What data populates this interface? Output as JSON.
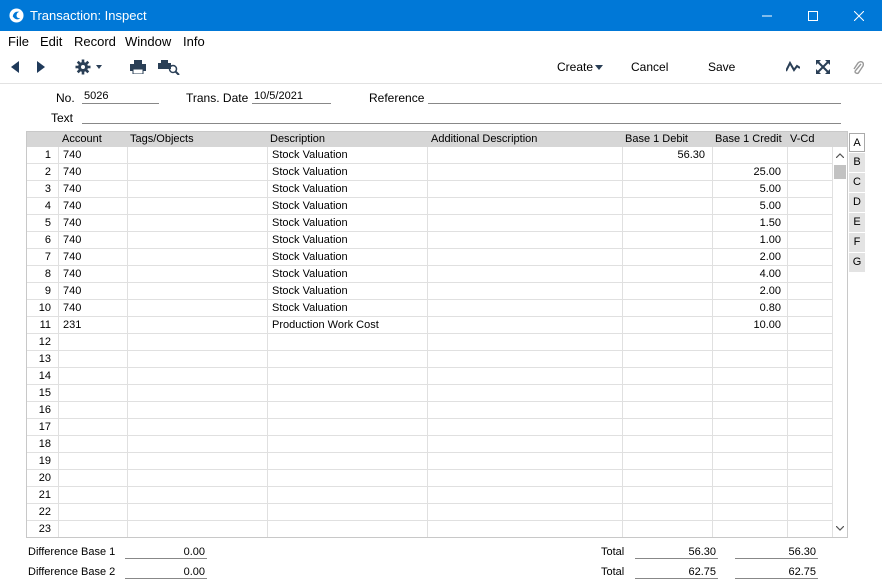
{
  "window": {
    "title": "Transaction: Inspect"
  },
  "menu": [
    "File",
    "Edit",
    "Record",
    "Window",
    "Info"
  ],
  "toolbar": {
    "create_label": "Create",
    "cancel_label": "Cancel",
    "save_label": "Save"
  },
  "header": {
    "no_label": "No.",
    "no_value": "5026",
    "date_label": "Trans. Date",
    "date_value": "10/5/2021",
    "reference_label": "Reference",
    "reference_value": "",
    "text_label": "Text",
    "text_value": ""
  },
  "grid": {
    "columns": [
      "Account",
      "Tags/Objects",
      "Description",
      "Additional Description",
      "Base 1 Debit",
      "Base 1 Credit",
      "V-Cd"
    ],
    "rows": [
      {
        "n": "1",
        "account": "740",
        "desc": "Stock Valuation",
        "debit": "56.30",
        "credit": ""
      },
      {
        "n": "2",
        "account": "740",
        "desc": "Stock Valuation",
        "debit": "",
        "credit": "25.00"
      },
      {
        "n": "3",
        "account": "740",
        "desc": "Stock Valuation",
        "debit": "",
        "credit": "5.00"
      },
      {
        "n": "4",
        "account": "740",
        "desc": "Stock Valuation",
        "debit": "",
        "credit": "5.00"
      },
      {
        "n": "5",
        "account": "740",
        "desc": "Stock Valuation",
        "debit": "",
        "credit": "1.50"
      },
      {
        "n": "6",
        "account": "740",
        "desc": "Stock Valuation",
        "debit": "",
        "credit": "1.00"
      },
      {
        "n": "7",
        "account": "740",
        "desc": "Stock Valuation",
        "debit": "",
        "credit": "2.00"
      },
      {
        "n": "8",
        "account": "740",
        "desc": "Stock Valuation",
        "debit": "",
        "credit": "4.00"
      },
      {
        "n": "9",
        "account": "740",
        "desc": "Stock Valuation",
        "debit": "",
        "credit": "2.00"
      },
      {
        "n": "10",
        "account": "740",
        "desc": "Stock Valuation",
        "debit": "",
        "credit": "0.80"
      },
      {
        "n": "11",
        "account": "231",
        "desc": "Production Work Cost",
        "debit": "",
        "credit": "10.00"
      },
      {
        "n": "12",
        "account": "",
        "desc": "",
        "debit": "",
        "credit": ""
      },
      {
        "n": "13",
        "account": "",
        "desc": "",
        "debit": "",
        "credit": ""
      },
      {
        "n": "14",
        "account": "",
        "desc": "",
        "debit": "",
        "credit": ""
      },
      {
        "n": "15",
        "account": "",
        "desc": "",
        "debit": "",
        "credit": ""
      },
      {
        "n": "16",
        "account": "",
        "desc": "",
        "debit": "",
        "credit": ""
      },
      {
        "n": "17",
        "account": "",
        "desc": "",
        "debit": "",
        "credit": ""
      },
      {
        "n": "18",
        "account": "",
        "desc": "",
        "debit": "",
        "credit": ""
      },
      {
        "n": "19",
        "account": "",
        "desc": "",
        "debit": "",
        "credit": ""
      },
      {
        "n": "20",
        "account": "",
        "desc": "",
        "debit": "",
        "credit": ""
      },
      {
        "n": "21",
        "account": "",
        "desc": "",
        "debit": "",
        "credit": ""
      },
      {
        "n": "22",
        "account": "",
        "desc": "",
        "debit": "",
        "credit": ""
      },
      {
        "n": "23",
        "account": "",
        "desc": "",
        "debit": "",
        "credit": ""
      }
    ]
  },
  "tabs": [
    "A",
    "B",
    "C",
    "D",
    "E",
    "F",
    "G"
  ],
  "footer": {
    "diff1_label": "Difference Base 1",
    "diff1_value": "0.00",
    "diff2_label": "Difference Base 2",
    "diff2_value": "0.00",
    "total1_label": "Total",
    "total1_debit": "56.30",
    "total1_credit": "56.30",
    "total2_label": "Total",
    "total2_debit": "62.75",
    "total2_credit": "62.75"
  }
}
